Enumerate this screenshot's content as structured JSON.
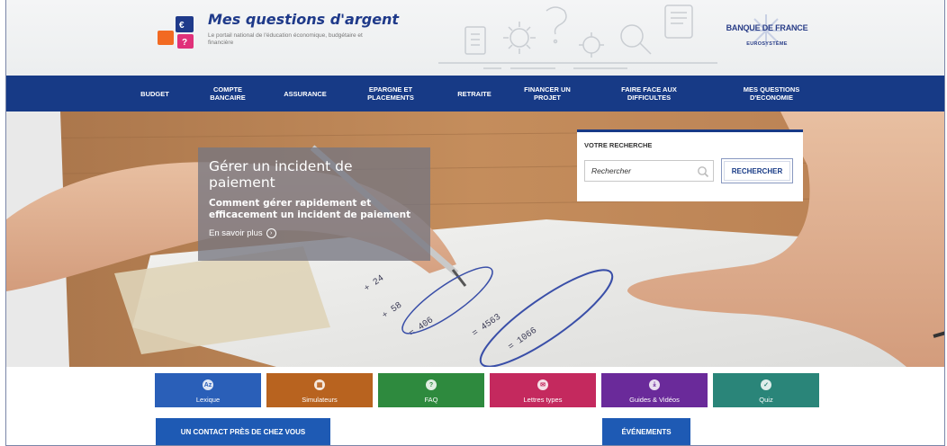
{
  "header": {
    "logo_title": "Mes questions d'argent",
    "logo_subtitle": "Le portail national de l'éducation économique, budgétaire et financière",
    "partner_name": "BANQUE DE FRANCE",
    "partner_tag": "EUROSYSTÈME"
  },
  "nav": {
    "items": [
      {
        "label": "BUDGET"
      },
      {
        "label": "COMPTE BANCAIRE"
      },
      {
        "label": "ASSURANCE"
      },
      {
        "label": "EPARGNE ET PLACEMENTS"
      },
      {
        "label": "RETRAITE"
      },
      {
        "label": "FINANCER UN PROJET"
      },
      {
        "label": "FAIRE FACE AUX DIFFICULTES"
      },
      {
        "label": "MES QUESTIONS D'ECONOMIE"
      }
    ]
  },
  "promo": {
    "title": "Gérer un incident de paiement",
    "description": "Comment gérer rapidement et efficacement un incident de paiement",
    "link": "En savoir plus"
  },
  "search": {
    "label": "VOTRE RECHERCHE",
    "placeholder": "Rechercher",
    "button": "RECHERCHER"
  },
  "tiles": [
    {
      "label": "Lexique",
      "glyph": "Az",
      "icon": "dictionary-icon",
      "color": "#2a5fb8"
    },
    {
      "label": "Simulateurs",
      "glyph": "▦",
      "icon": "calculator-icon",
      "color": "#b8631f"
    },
    {
      "label": "FAQ",
      "glyph": "?",
      "icon": "question-icon",
      "color": "#2e8a3e"
    },
    {
      "label": "Lettres types",
      "glyph": "✉",
      "icon": "letter-icon",
      "color": "#c4295e"
    },
    {
      "label": "Guides & Vidéos",
      "glyph": "⤓",
      "icon": "download-icon",
      "color": "#6a2a9a"
    },
    {
      "label": "Quiz",
      "glyph": "✓",
      "icon": "check-icon",
      "color": "#2a8579"
    }
  ],
  "ctas": {
    "contact": "UN CONTACT PRÈS DE CHEZ VOUS",
    "events": "ÉVÉNEMENTS"
  },
  "colors": {
    "nav_bg": "#173a86",
    "brand_blue": "#1f3a8a",
    "cta_blue": "#1e5ab4"
  }
}
